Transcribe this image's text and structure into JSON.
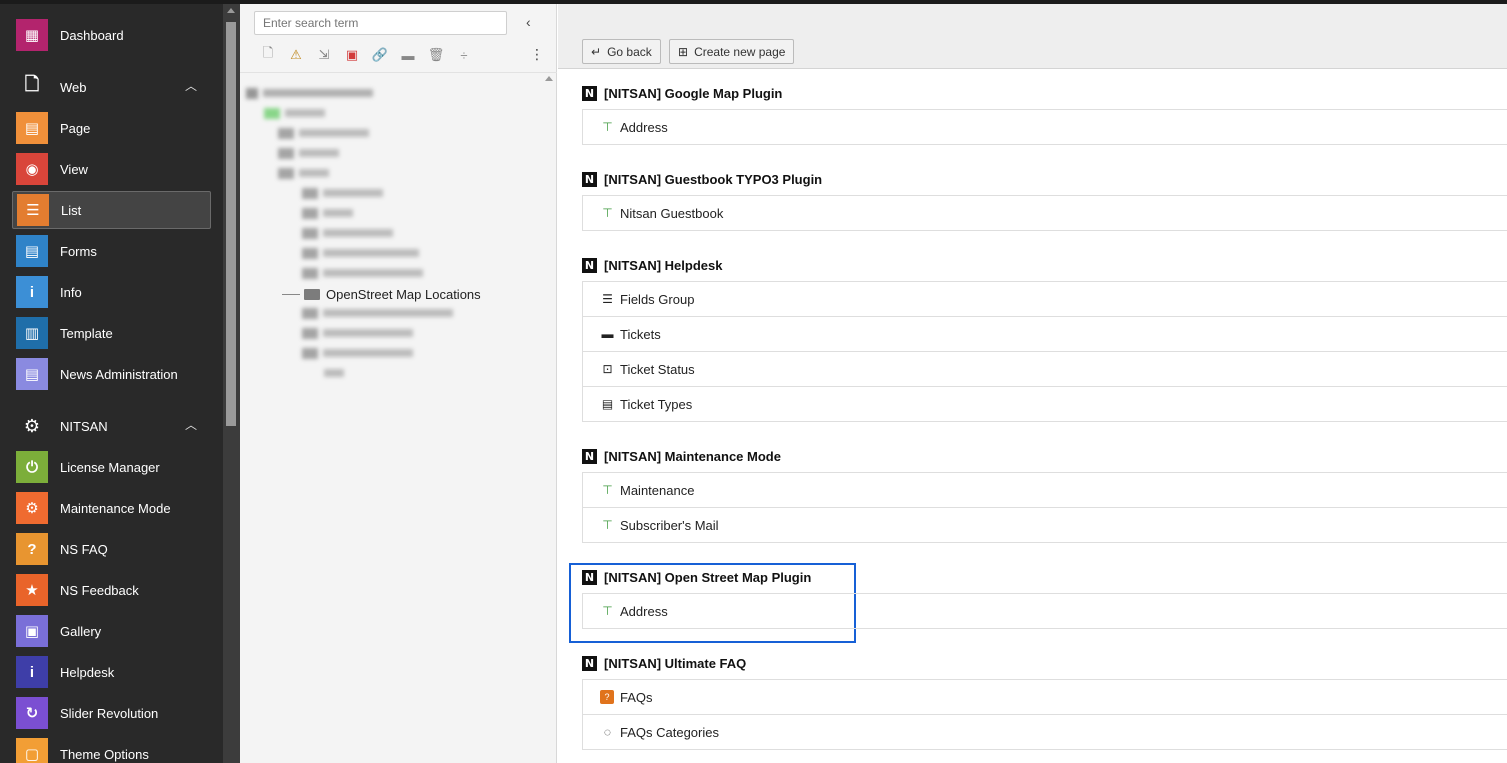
{
  "sidebar": {
    "items": [
      {
        "label": "Dashboard",
        "icon": "dashboard-icon",
        "color": "#b3246d",
        "glyph": "▦",
        "group": false
      },
      {
        "label": "Web",
        "icon": "page-outline-icon",
        "color": "transparent",
        "glyph": "🗋",
        "group": true
      },
      {
        "label": "Page",
        "icon": "page-icon",
        "color": "#f0903a",
        "glyph": "▤",
        "group": false
      },
      {
        "label": "View",
        "icon": "eye-icon",
        "color": "#d9453a",
        "glyph": "◉",
        "group": false
      },
      {
        "label": "List",
        "icon": "list-icon",
        "color": "#e37d30",
        "glyph": "☰",
        "group": false,
        "active": true
      },
      {
        "label": "Forms",
        "icon": "forms-icon",
        "color": "#2f83c8",
        "glyph": "▤",
        "group": false
      },
      {
        "label": "Info",
        "icon": "info-icon",
        "color": "#3c8fd6",
        "glyph": "i",
        "group": false
      },
      {
        "label": "Template",
        "icon": "template-icon",
        "color": "#1f6ea9",
        "glyph": "▥",
        "group": false
      },
      {
        "label": "News Administration",
        "icon": "news-icon",
        "color": "#8a8ae0",
        "glyph": "▤",
        "group": false
      },
      {
        "label": "NITSAN",
        "icon": "gear-icon",
        "color": "transparent",
        "glyph": "⚙",
        "group": true
      },
      {
        "label": "License Manager",
        "icon": "power-icon",
        "color": "#7cae3a",
        "glyph": "⏻",
        "group": false
      },
      {
        "label": "Maintenance Mode",
        "icon": "maintenance-icon",
        "color": "#ef6b30",
        "glyph": "⚙",
        "group": false
      },
      {
        "label": "NS FAQ",
        "icon": "faq-icon",
        "color": "#e89530",
        "glyph": "?",
        "group": false
      },
      {
        "label": "NS Feedback",
        "icon": "star-icon",
        "color": "#e9642a",
        "glyph": "★",
        "group": false
      },
      {
        "label": "Gallery",
        "icon": "gallery-icon",
        "color": "#7a6fd8",
        "glyph": "▣",
        "group": false
      },
      {
        "label": "Helpdesk",
        "icon": "helpdesk-icon",
        "color": "#3e3ea8",
        "glyph": "i",
        "group": false
      },
      {
        "label": "Slider Revolution",
        "icon": "slider-icon",
        "color": "#7b4fd2",
        "glyph": "↻",
        "group": false
      },
      {
        "label": "Theme Options",
        "icon": "theme-icon",
        "color": "#f29e35",
        "glyph": "▢",
        "group": false
      }
    ]
  },
  "tree": {
    "search_placeholder": "Enter search term",
    "selected_node": "OpenStreet Map Locations"
  },
  "header": {
    "go_back": "Go back",
    "create_new_page": "Create new page"
  },
  "extensions": [
    {
      "title": "[NITSAN] Google Map Plugin",
      "rows": [
        {
          "label": "Address",
          "icon": "sitemap-icon"
        }
      ]
    },
    {
      "title": "[NITSAN] Guestbook TYPO3 Plugin",
      "rows": [
        {
          "label": "Nitsan Guestbook",
          "icon": "sitemap-icon"
        }
      ]
    },
    {
      "title": "[NITSAN] Helpdesk",
      "rows": [
        {
          "label": "Fields Group",
          "icon": "fields-group-icon"
        },
        {
          "label": "Tickets",
          "icon": "ticket-icon"
        },
        {
          "label": "Ticket Status",
          "icon": "ticket-status-icon"
        },
        {
          "label": "Ticket Types",
          "icon": "ticket-types-icon"
        }
      ]
    },
    {
      "title": "[NITSAN] Maintenance Mode",
      "rows": [
        {
          "label": "Maintenance",
          "icon": "sitemap-icon"
        },
        {
          "label": "Subscriber's Mail",
          "icon": "sitemap-icon"
        }
      ]
    },
    {
      "title": "[NITSAN] Open Street Map Plugin",
      "rows": [
        {
          "label": "Address",
          "icon": "sitemap-icon"
        }
      ]
    },
    {
      "title": "[NITSAN] Ultimate FAQ",
      "rows": [
        {
          "label": "FAQs",
          "icon": "faq-icon"
        },
        {
          "label": "FAQs Categories",
          "icon": "faq-category-icon"
        }
      ]
    }
  ]
}
